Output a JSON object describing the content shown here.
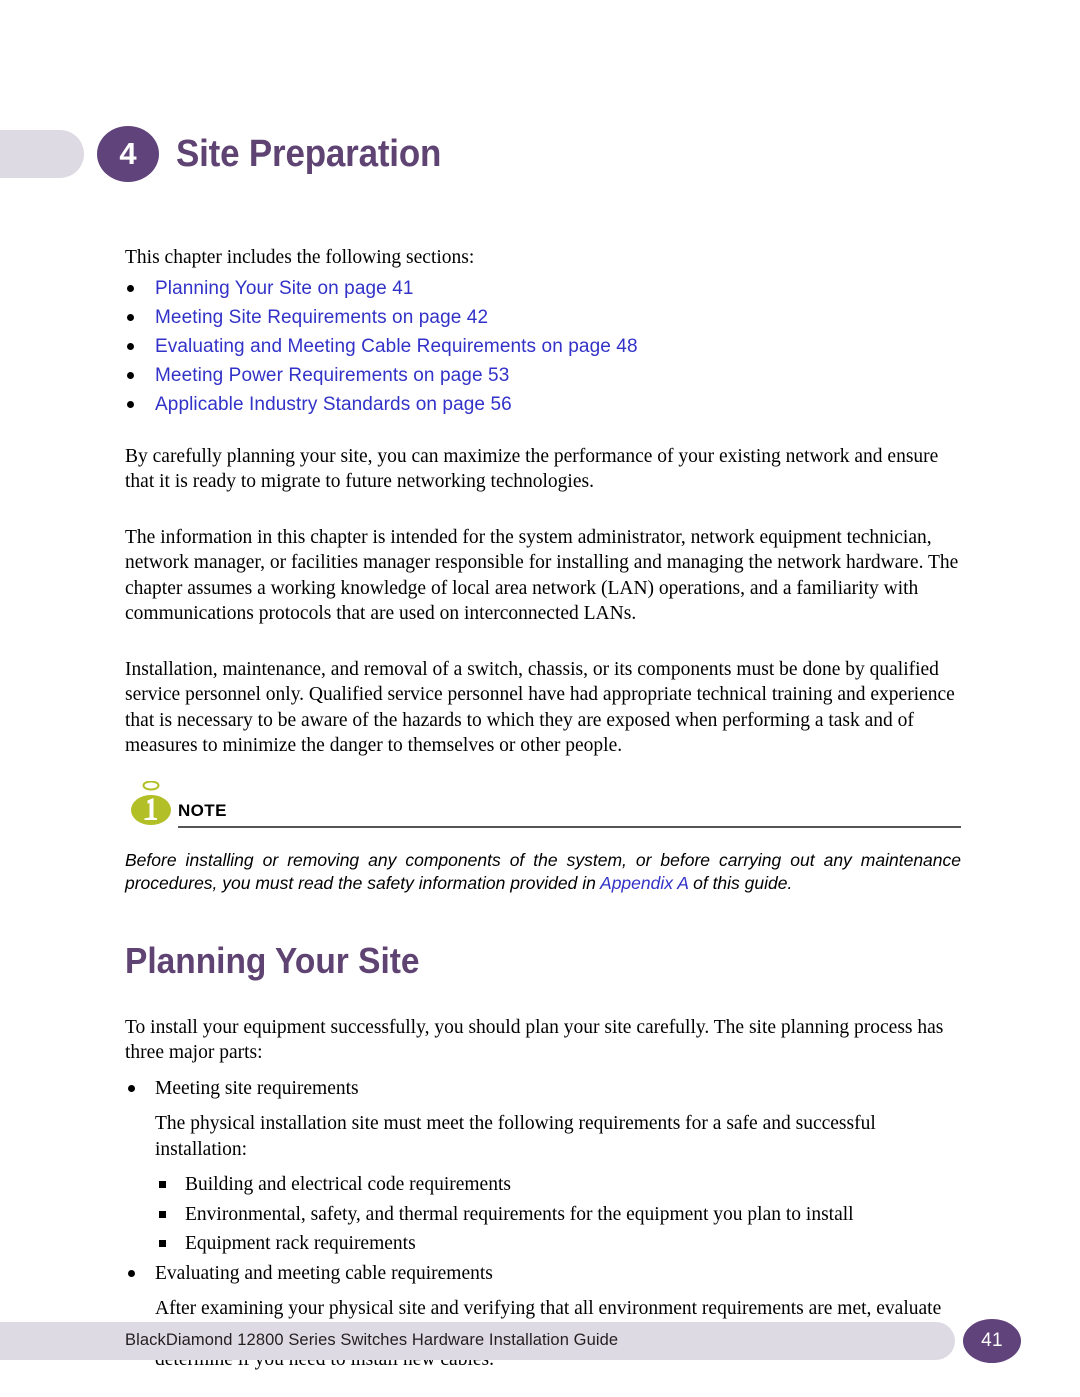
{
  "chapter": {
    "number": "4",
    "title": "Site Preparation"
  },
  "intro": {
    "lead": "This chapter includes the following sections:",
    "toc": [
      {
        "label": "Planning Your Site on page 41"
      },
      {
        "label": "Meeting Site Requirements on page 42"
      },
      {
        "label": "Evaluating and Meeting Cable Requirements on page 48"
      },
      {
        "label": "Meeting Power Requirements on page 53"
      },
      {
        "label": "Applicable Industry Standards on page 56"
      }
    ],
    "paragraph_1": "By carefully planning your site, you can maximize the performance of your existing network and ensure that it is ready to migrate to future networking technologies.",
    "paragraph_2": "The information in this chapter is intended for the system administrator, network equipment technician, network manager, or facilities manager responsible for installing and managing the network hardware. The chapter assumes a working knowledge of local area network (LAN) operations, and a familiarity with communications protocols that are used on interconnected LANs.",
    "paragraph_3": "Installation, maintenance, and removal of a switch, chassis, or its components must be done by qualified service personnel only. Qualified service personnel have had appropriate technical training and experience that is necessary to be aware of the hazards to which they are exposed when performing a task and of measures to minimize the danger to themselves or other people."
  },
  "note": {
    "label": "NOTE",
    "text_before_link": "Before installing or removing any components of the system, or before carrying out any maintenance procedures, you must read the safety information provided in ",
    "link": "Appendix A",
    "text_after_link": " of this guide."
  },
  "section": {
    "heading": "Planning Your Site",
    "intro": "To install your equipment successfully, you should plan your site carefully. The site planning process has three major parts:",
    "bullet_1": "Meeting site requirements",
    "bullet_1_detail": "The physical installation site must meet the following requirements for a safe and successful installation:",
    "sub_bullets": [
      {
        "label": "Building and electrical code requirements"
      },
      {
        "label": "Environmental, safety, and thermal requirements for the equipment you plan to install"
      },
      {
        "label": "Equipment rack requirements"
      }
    ],
    "bullet_2": "Evaluating and meeting cable requirements",
    "bullet_2_detail": "After examining your physical site and verifying that all environment requirements are met, evaluate and compare your existing cable plant with the requirements of the Extreme Networks equipment to determine if you need to install new cables."
  },
  "footer": {
    "guide_title": "BlackDiamond 12800 Series Switches Hardware Installation Guide",
    "page_number": "41"
  },
  "colors": {
    "purple": "#60437A",
    "lavender": "#DEDAE4",
    "link_blue": "#3232C8",
    "note_olive": "#B3BF26"
  }
}
